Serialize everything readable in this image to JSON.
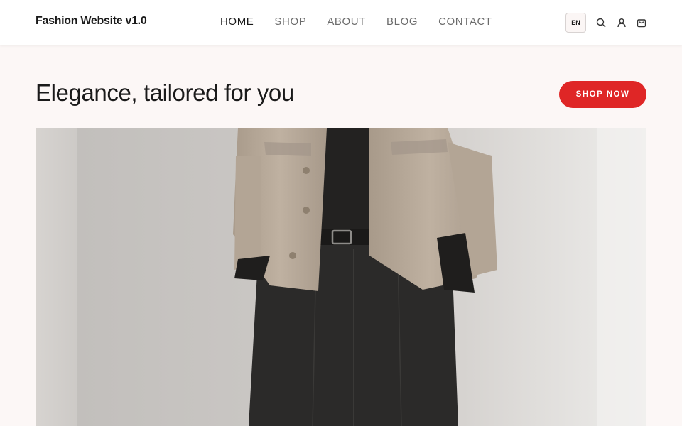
{
  "header": {
    "logo": "Fashion Website v1.0",
    "nav": [
      {
        "label": "HOME",
        "active": true
      },
      {
        "label": "SHOP",
        "active": false
      },
      {
        "label": "ABOUT",
        "active": false
      },
      {
        "label": "BLOG",
        "active": false
      },
      {
        "label": "CONTACT",
        "active": false
      }
    ],
    "language": "EN",
    "icons": [
      "search-icon",
      "user-icon",
      "cart-icon"
    ]
  },
  "hero": {
    "title": "Elegance, tailored for you",
    "cta_label": "SHOP NOW",
    "image_subject": "model-in-beige-jacket-and-black-trousers"
  },
  "colors": {
    "accent": "#df2626",
    "page_background": "#fcf7f6",
    "header_background": "#ffffff"
  }
}
